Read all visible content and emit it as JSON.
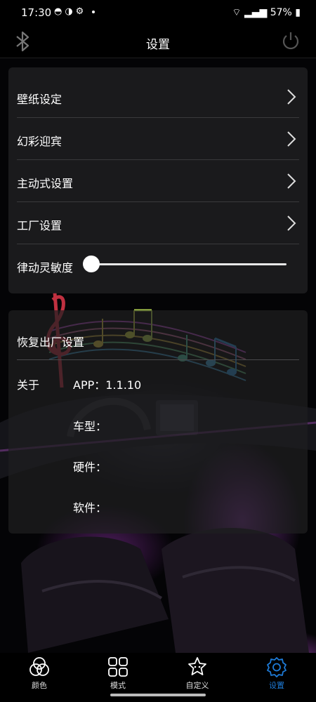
{
  "status_bar": {
    "time": "17:30",
    "battery": "57%"
  },
  "header": {
    "title": "设置"
  },
  "settings": {
    "items": [
      {
        "label": "壁纸设定"
      },
      {
        "label": "幻彩迎宾"
      },
      {
        "label": "主动式设置"
      },
      {
        "label": "工厂设置"
      }
    ],
    "sensitivity_label": "律动灵敏度",
    "sensitivity_value": 0
  },
  "about": {
    "reset_label": "恢复出厂设置",
    "about_label": "关于",
    "app_version": "APP：1.1.10",
    "car_model_label": "车型：",
    "hardware_label": "硬件：",
    "software_label": "软件："
  },
  "nav": {
    "items": [
      {
        "label": "颜色",
        "icon": "color-circles-icon"
      },
      {
        "label": "模式",
        "icon": "grid-mode-icon"
      },
      {
        "label": "自定义",
        "icon": "custom-star-icon"
      },
      {
        "label": "设置",
        "icon": "gear-icon"
      }
    ],
    "active_index": 3,
    "active_color": "#1e7bd8"
  }
}
